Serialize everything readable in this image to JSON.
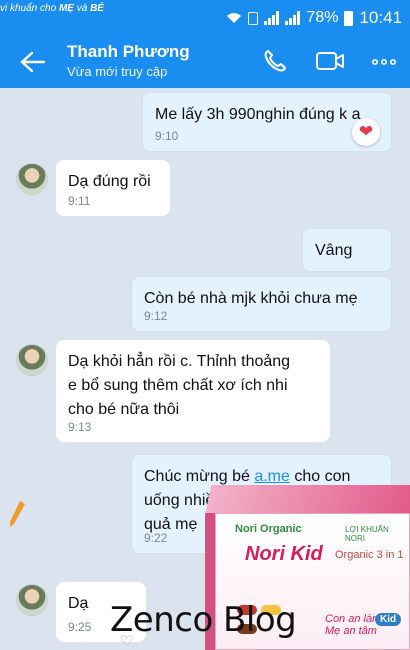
{
  "promo": {
    "text_prefix": "vi khuẩn cho ",
    "text_strong1": "MẸ",
    "text_mid": " và ",
    "text_strong2": "BÉ"
  },
  "status_bar": {
    "battery": "78%",
    "time": "10:41"
  },
  "header": {
    "name": "Thanh Phương",
    "status": "Vừa mới truy cập"
  },
  "messages": [
    {
      "dir": "out",
      "text": "Me lấy 3h 990nghin đúng k a",
      "time": "9:10"
    },
    {
      "dir": "in",
      "text": "Dạ đúng rồi",
      "time": "9:11"
    },
    {
      "dir": "out",
      "text": "Vâng",
      "time": ""
    },
    {
      "dir": "out",
      "text": "Còn bé nhà mjk khỏi chưa mẹ",
      "time": "9:12"
    },
    {
      "dir": "in",
      "lines": [
        "Dạ khỏi hẳn rồi c. Thỉnh thoảng",
        "e bổ sung thêm chất xơ ích nhi",
        "cho bé nữa thôi"
      ],
      "time": "9:13"
    },
    {
      "dir": "out",
      "line1_pre": "Chúc mừng bé ",
      "line1_link": "a.me",
      "line1_post": " cho con",
      "line2": "uống nhiều nước ă",
      "line3": "quả mẹ",
      "time": "9:22"
    },
    {
      "dir": "in",
      "text": "Dạ",
      "time": "9:25"
    }
  ],
  "reactions": {
    "heart": "❤",
    "heart_outline": "♡"
  },
  "product": {
    "brand": "Nori Organic",
    "title": "Nori Kid",
    "subtitle": "Organic 3 in 1",
    "tag": "LỢI KHUẨN NORI",
    "slogan_line1": "Con an lành",
    "slogan_line2": "Mẹ an tâm",
    "kid_badge": "Kid"
  },
  "watermark": "Zenco Blog",
  "colors": {
    "header_bg": "#1a8ef0",
    "chat_bg": "#dbe4ee",
    "out_bubble": "#e4f1ff",
    "in_bubble": "#ffffff",
    "accent_pink": "#d81b5c"
  },
  "icons": [
    "back-arrow-icon",
    "phone-icon",
    "video-camera-icon",
    "more-dots-icon",
    "wifi-icon",
    "signal-icon",
    "battery-icon",
    "heart-icon"
  ]
}
